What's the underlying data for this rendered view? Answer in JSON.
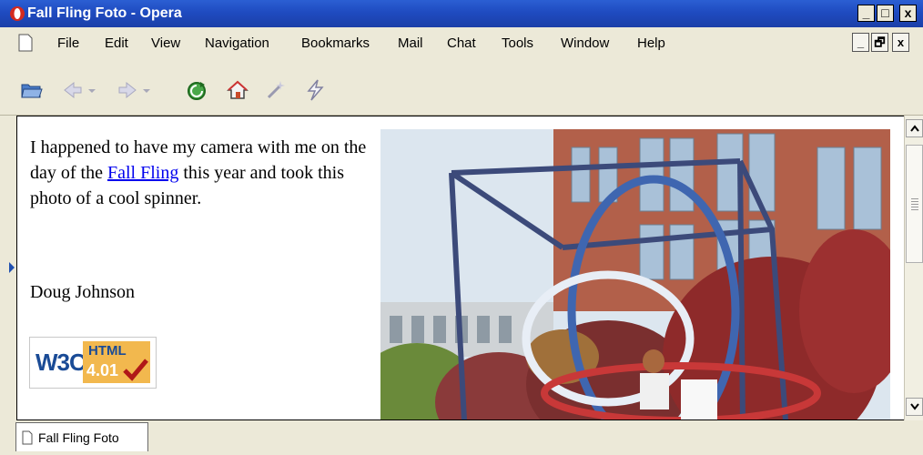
{
  "window": {
    "title": "Fall Fling Foto - Opera",
    "minimize": "_",
    "maximize": "□",
    "close": "x"
  },
  "menu": {
    "items": [
      "File",
      "Edit",
      "View",
      "Navigation",
      "Bookmarks",
      "Mail",
      "Chat",
      "Tools",
      "Window",
      "Help"
    ]
  },
  "mdi": {
    "minimize": "_",
    "restore": "🗗",
    "close": "x"
  },
  "toolbar": {
    "icons": [
      "open-folder-icon",
      "back-icon",
      "back-dropdown-icon",
      "forward-icon",
      "forward-dropdown-icon",
      "reload-icon",
      "home-icon",
      "wand-icon",
      "speed-dial-icon"
    ]
  },
  "content": {
    "para_before": "I happened to have my camera with me on the day of the ",
    "link": "Fall Fling",
    "para_after": " this year and took this photo of a cool spinner.",
    "author": "Doug Johnson",
    "badge": {
      "w3c": "W3C",
      "html": "HTML",
      "version": "4.01"
    }
  },
  "tabs": [
    {
      "label": "Fall Fling Foto"
    }
  ],
  "colors": {
    "titlebar": "#1f4bc0",
    "link": "#0000ee",
    "chrome": "#ece9d8"
  }
}
